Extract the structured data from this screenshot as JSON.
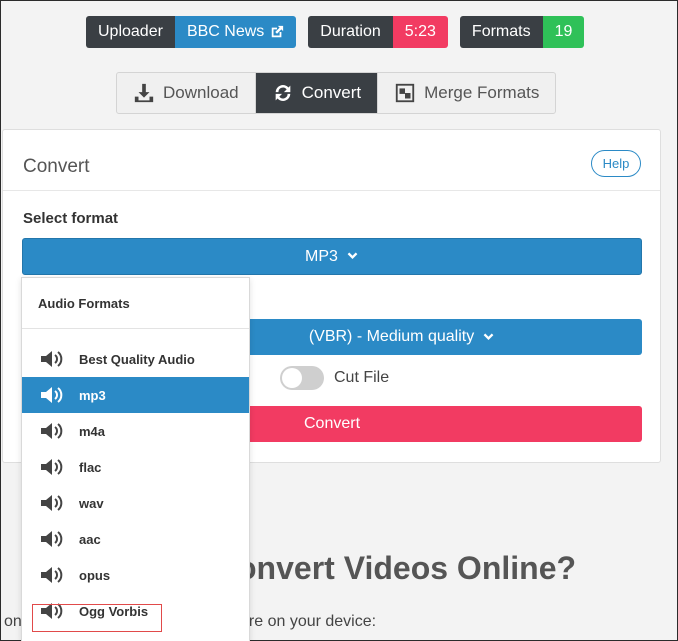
{
  "badges": {
    "uploader": {
      "key": "Uploader",
      "value": "BBC News"
    },
    "duration": {
      "key": "Duration",
      "value": "5:23"
    },
    "formats": {
      "key": "Formats",
      "value": "19"
    }
  },
  "tabs": [
    {
      "label": "Download",
      "icon": "download-icon"
    },
    {
      "label": "Convert",
      "icon": "sync-icon",
      "active": true
    },
    {
      "label": "Merge Formats",
      "icon": "merge-icon"
    }
  ],
  "card": {
    "title": "Convert",
    "help_label": "Help",
    "select_label": "Select format",
    "selected_format": "MP3",
    "quality_value": "(VBR) - Medium quality",
    "cut_file_label": "Cut File",
    "convert_label": "Convert"
  },
  "dropdown": {
    "header": "Audio Formats",
    "items": [
      {
        "label": "Best Quality Audio"
      },
      {
        "label": "mp3",
        "selected": true
      },
      {
        "label": "m4a"
      },
      {
        "label": "flac"
      },
      {
        "label": "wav"
      },
      {
        "label": "aac"
      },
      {
        "label": "opus"
      },
      {
        "label": "Ogg Vorbis",
        "highlighted": true
      }
    ]
  },
  "background": {
    "heading_fragment": "onvert Videos Online?",
    "text_left": "on",
    "text_right": "are on your device:"
  },
  "colors": {
    "accent_blue": "#2b8ac6",
    "dark": "#3a3f44",
    "red": "#f23b62",
    "green": "#2fc158"
  }
}
